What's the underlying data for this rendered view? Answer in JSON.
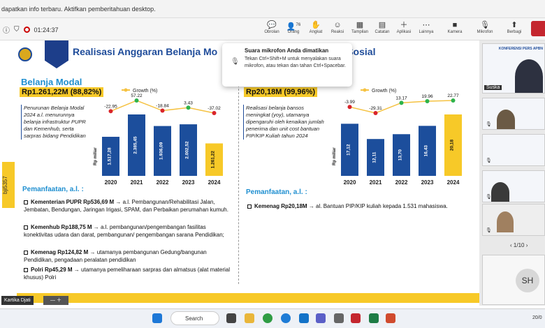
{
  "notification_bar": {
    "text": "dapatkan info terbaru. Aktifkan pemberitahuan desktop."
  },
  "toolbar": {
    "timer": "01:24:37",
    "buttons": [
      {
        "label": "Obrolan",
        "icon": "chat-icon"
      },
      {
        "label": "Orang",
        "icon": "people-icon",
        "badge": "76"
      },
      {
        "label": "Angkat",
        "icon": "raise-hand-icon"
      },
      {
        "label": "Reaksi",
        "icon": "reaction-icon"
      },
      {
        "label": "Tampilan",
        "icon": "view-icon"
      },
      {
        "label": "Catatan",
        "icon": "notes-icon"
      },
      {
        "label": "Aplikasi",
        "icon": "apps-icon"
      },
      {
        "label": "Lainnya",
        "icon": "more-icon"
      },
      {
        "label": "Kamera",
        "icon": "camera-icon"
      },
      {
        "label": "Mikrofon",
        "icon": "mic-icon"
      },
      {
        "label": "Berbagi",
        "icon": "share-icon"
      }
    ]
  },
  "popup": {
    "title": "Suara mikrofon Anda dimatikan",
    "body": "Tekan Ctrl+Shift+M untuk menyalakan suara mikrofon, atau tekan dan tahan Ctrl+Spacebar."
  },
  "slide": {
    "title": "Realisasi Anggaran Belanja Mo",
    "title_tail": "Sosial",
    "side_tab": "bji5357",
    "left": {
      "section": "Belanja Modal",
      "amount": "Rp1.261,22M (88,82%)",
      "description": "Penurunan Belanja Modal 2024 a.l. menurunnya belanja infrastruktur PUPR dan Kemenhub, serta sarpras bidang Pendidikan",
      "pemanfaatan": "Pemanfaatan, a.l. :",
      "bullets": [
        {
          "bold": "Kementerian PUPR Rp536,69 M",
          "text": " → a.l. Pembangunan/Rehabilitasi Jalan, Jembatan, Bendungan, Jaringan Irigasi, SPAM, dan Perbaikan perumahan kumuh."
        },
        {
          "bold": "Kemenhub Rp188,75 M",
          "text": " → a.l. pembangunan/pengembangan fasilitas konektivitas udara dan darat, pembangunan/ pengembangan sarana Pendidikan;"
        },
        {
          "bold": "Kemenag Rp124,82 M",
          "text": " → utamanya pembangunan Gedung/bangunan Pendidikan, pengadaan peralatan pendidikan"
        },
        {
          "bold": "Polri Rp45,29 M",
          "text": " → utamanya pemeliharaan sarpras dan almatsus (alat material khusus) Polri"
        }
      ]
    },
    "right": {
      "amount": "Rp20,18M (99,96%)",
      "description": "Realisasi belanja bansos meningkat (yoy), utamanya dipengaruhi oleh kenaikan jumlah penerima dan unit cost bantuan PIP/KIP Kuliah tahun 2024",
      "pemanfaatan": "Pemanfaatan, a.l. :",
      "bullets": [
        {
          "bold": "Kemenag Rp20,18M",
          "text": " → al. Bantuan PIP/KIP kuliah kepada 1.531 mahasiswa."
        }
      ]
    }
  },
  "chart_data": [
    {
      "type": "bar",
      "categories": [
        "2020",
        "2021",
        "2022",
        "2023",
        "2024"
      ],
      "series": [
        {
          "name": "",
          "values": [
            1517.28,
            2385.45,
            1936.09,
            2002.52,
            1261.22
          ],
          "labels": [
            "1.517,28",
            "2.385,45",
            "1.936,09",
            "2.002,52",
            "1.261,22"
          ]
        },
        {
          "name": "Growth (%)",
          "type": "line",
          "values": [
            -22.95,
            57.22,
            -18.84,
            3.43,
            -37.02
          ],
          "labels": [
            "-22.95",
            "57.22",
            "-18.84",
            "3.43",
            "-37.02"
          ]
        }
      ],
      "ylabel": "Rp miliar",
      "legend": "Growth (%)",
      "colors": {
        "bar": "#1c4e9c",
        "highlight": "#f7c928",
        "line": "#f5c242",
        "up": "#2db34a",
        "down": "#d9242a"
      }
    },
    {
      "type": "bar",
      "categories": [
        "2020",
        "2021",
        "2022",
        "2023",
        "2024"
      ],
      "series": [
        {
          "name": "",
          "values": [
            17.12,
            12.11,
            13.7,
            16.43,
            20.18
          ],
          "labels": [
            "17,12",
            "12,11",
            "13,70",
            "16,43",
            "20,18"
          ]
        },
        {
          "name": "Growth (%)",
          "type": "line",
          "values": [
            -3.99,
            -29.31,
            13.17,
            19.96,
            22.77
          ],
          "labels": [
            "-3.99",
            "-29.31",
            "13.17",
            "19.96",
            "22.77"
          ]
        }
      ],
      "ylabel": "Rp miliar",
      "legend": "Growth (%)",
      "colors": {
        "bar": "#1c4e9c",
        "highlight": "#f7c928",
        "line": "#f5c242",
        "up": "#2db34a",
        "down": "#d9242a"
      }
    }
  ],
  "participants": {
    "video_name": "Suska",
    "pager": "1/10",
    "avatar_initials": "SH",
    "conference_label": "KONFERENSI PERS APBN"
  },
  "presenter": {
    "name": "Kartika Djati"
  },
  "taskbar": {
    "search": "Search",
    "clock": "20/0"
  }
}
